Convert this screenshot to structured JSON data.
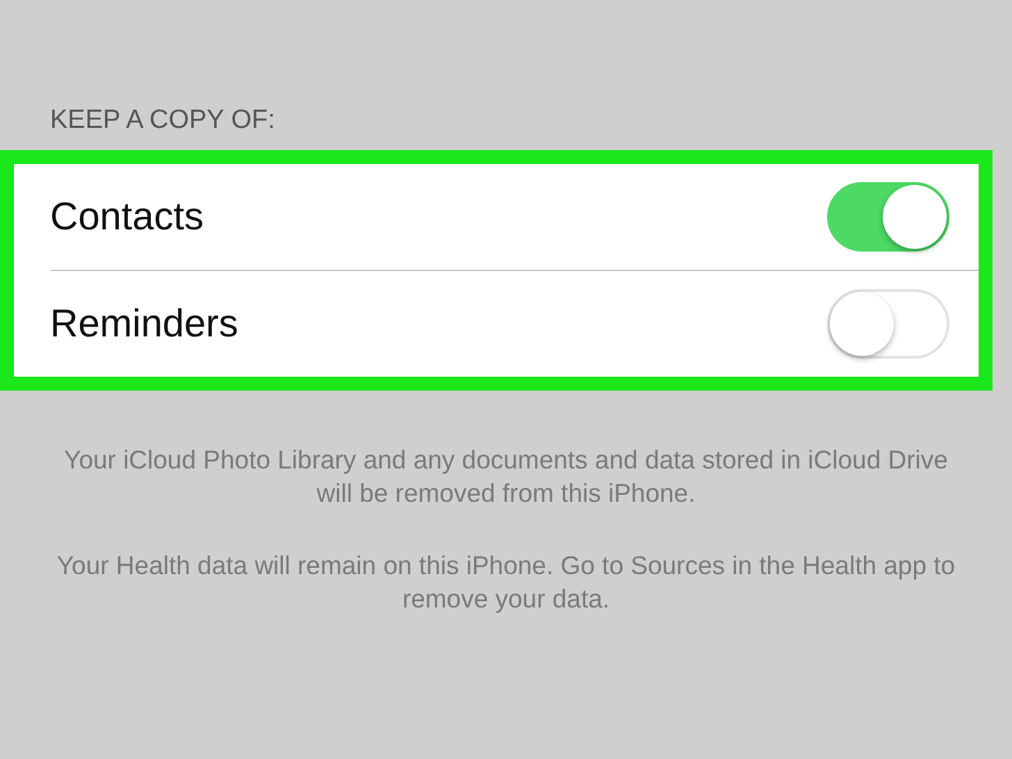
{
  "section_header": "KEEP A COPY OF:",
  "rows": [
    {
      "label": "Contacts",
      "on": true
    },
    {
      "label": "Reminders",
      "on": false
    }
  ],
  "highlighted": true,
  "notes": [
    "Your iCloud Photo Library and any documents and data stored in iCloud Drive will be removed from this iPhone.",
    "Your Health data will remain on this iPhone. Go to Sources in the Health app to remove your data."
  ]
}
